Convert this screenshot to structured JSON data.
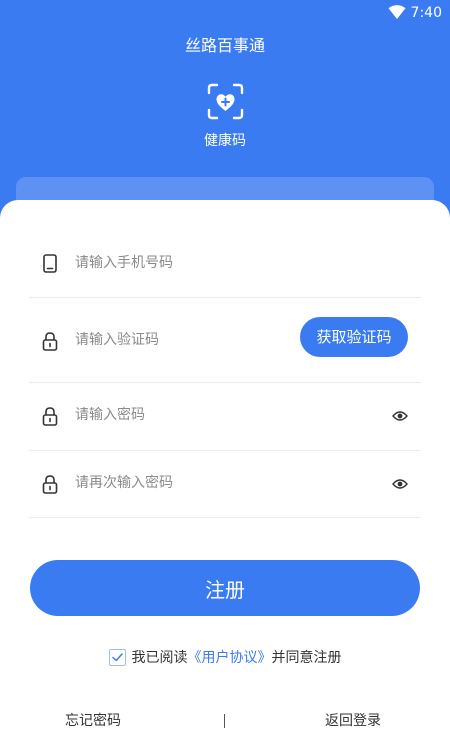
{
  "status_bar": {
    "time": "7:40",
    "wifi_icon": "wifi-icon"
  },
  "header": {
    "app_title": "丝路百事通",
    "health_code_icon": "health-code-icon",
    "health_code_label": "健康码"
  },
  "form": {
    "phone": {
      "icon": "phone-icon",
      "placeholder": "请输入手机号码",
      "value": ""
    },
    "code": {
      "icon": "lock-icon",
      "placeholder": "请输入验证码",
      "value": "",
      "send_button_label": "获取验证码"
    },
    "password": {
      "icon": "lock-icon",
      "placeholder": "请输入密码",
      "value": "",
      "toggle_icon": "eye-icon"
    },
    "confirm_password": {
      "icon": "lock-icon",
      "placeholder": "请再次输入密码",
      "value": "",
      "toggle_icon": "eye-icon"
    },
    "register_label": "注册"
  },
  "agreement": {
    "checked": true,
    "prefix": "我已阅读",
    "link": "《用户协议》",
    "suffix": "并同意注册"
  },
  "footer": {
    "forgot_password": "忘记密码",
    "separator": "|",
    "back_to_login": "返回登录"
  },
  "colors": {
    "primary": "#3a7bf2",
    "background": "#ffffff",
    "divider": "#ececec",
    "placeholder": "#8a8a8a",
    "text": "#333333"
  }
}
